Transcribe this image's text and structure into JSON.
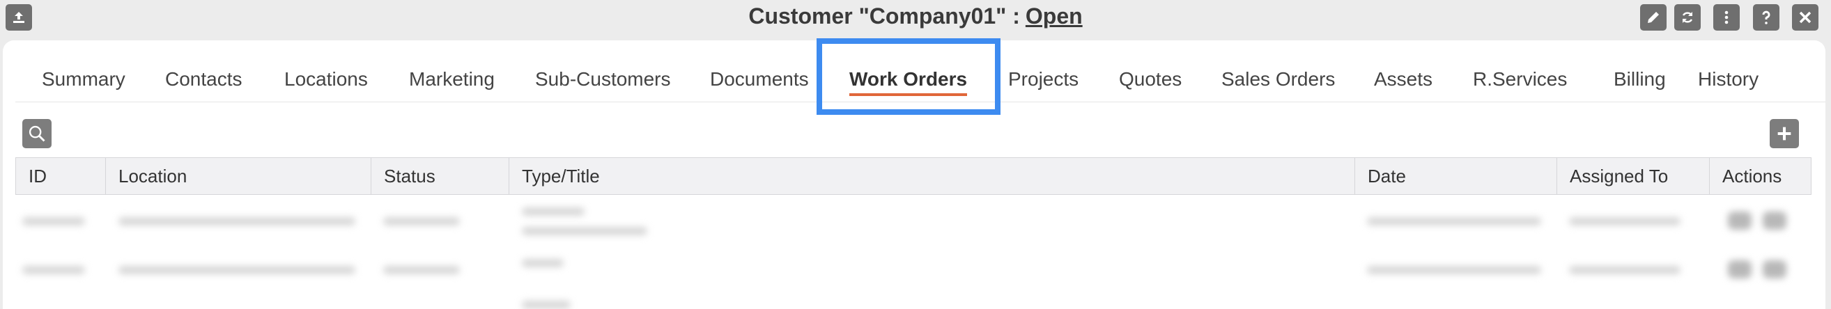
{
  "window": {
    "title_prefix": "Customer \"Company01\" :",
    "status": "Open"
  },
  "title_buttons": [
    {
      "name": "edit-icon"
    },
    {
      "name": "refresh-icon"
    },
    {
      "name": "more-vertical-icon"
    },
    {
      "name": "help-icon"
    },
    {
      "name": "close-icon"
    }
  ],
  "tabs": [
    {
      "label": "Summary",
      "active": false
    },
    {
      "label": "Contacts",
      "active": false
    },
    {
      "label": "Locations",
      "active": false
    },
    {
      "label": "Marketing",
      "active": false
    },
    {
      "label": "Sub-Customers",
      "active": false
    },
    {
      "label": "Documents",
      "active": false
    },
    {
      "label": "Work Orders",
      "active": true
    },
    {
      "label": "Projects",
      "active": false
    },
    {
      "label": "Quotes",
      "active": false
    },
    {
      "label": "Sales Orders",
      "active": false
    },
    {
      "label": "Assets",
      "active": false
    },
    {
      "label": "R.Services",
      "active": false
    },
    {
      "label": "Billing",
      "active": false
    },
    {
      "label": "History",
      "active": false
    }
  ],
  "table": {
    "columns": [
      "ID",
      "Location",
      "Status",
      "Type/Title",
      "Date",
      "Assigned To",
      "Actions"
    ]
  },
  "colors": {
    "accent_underline": "#e0673a",
    "highlight_box": "#3d8bf0",
    "button_gray": "#6f6f6f"
  }
}
